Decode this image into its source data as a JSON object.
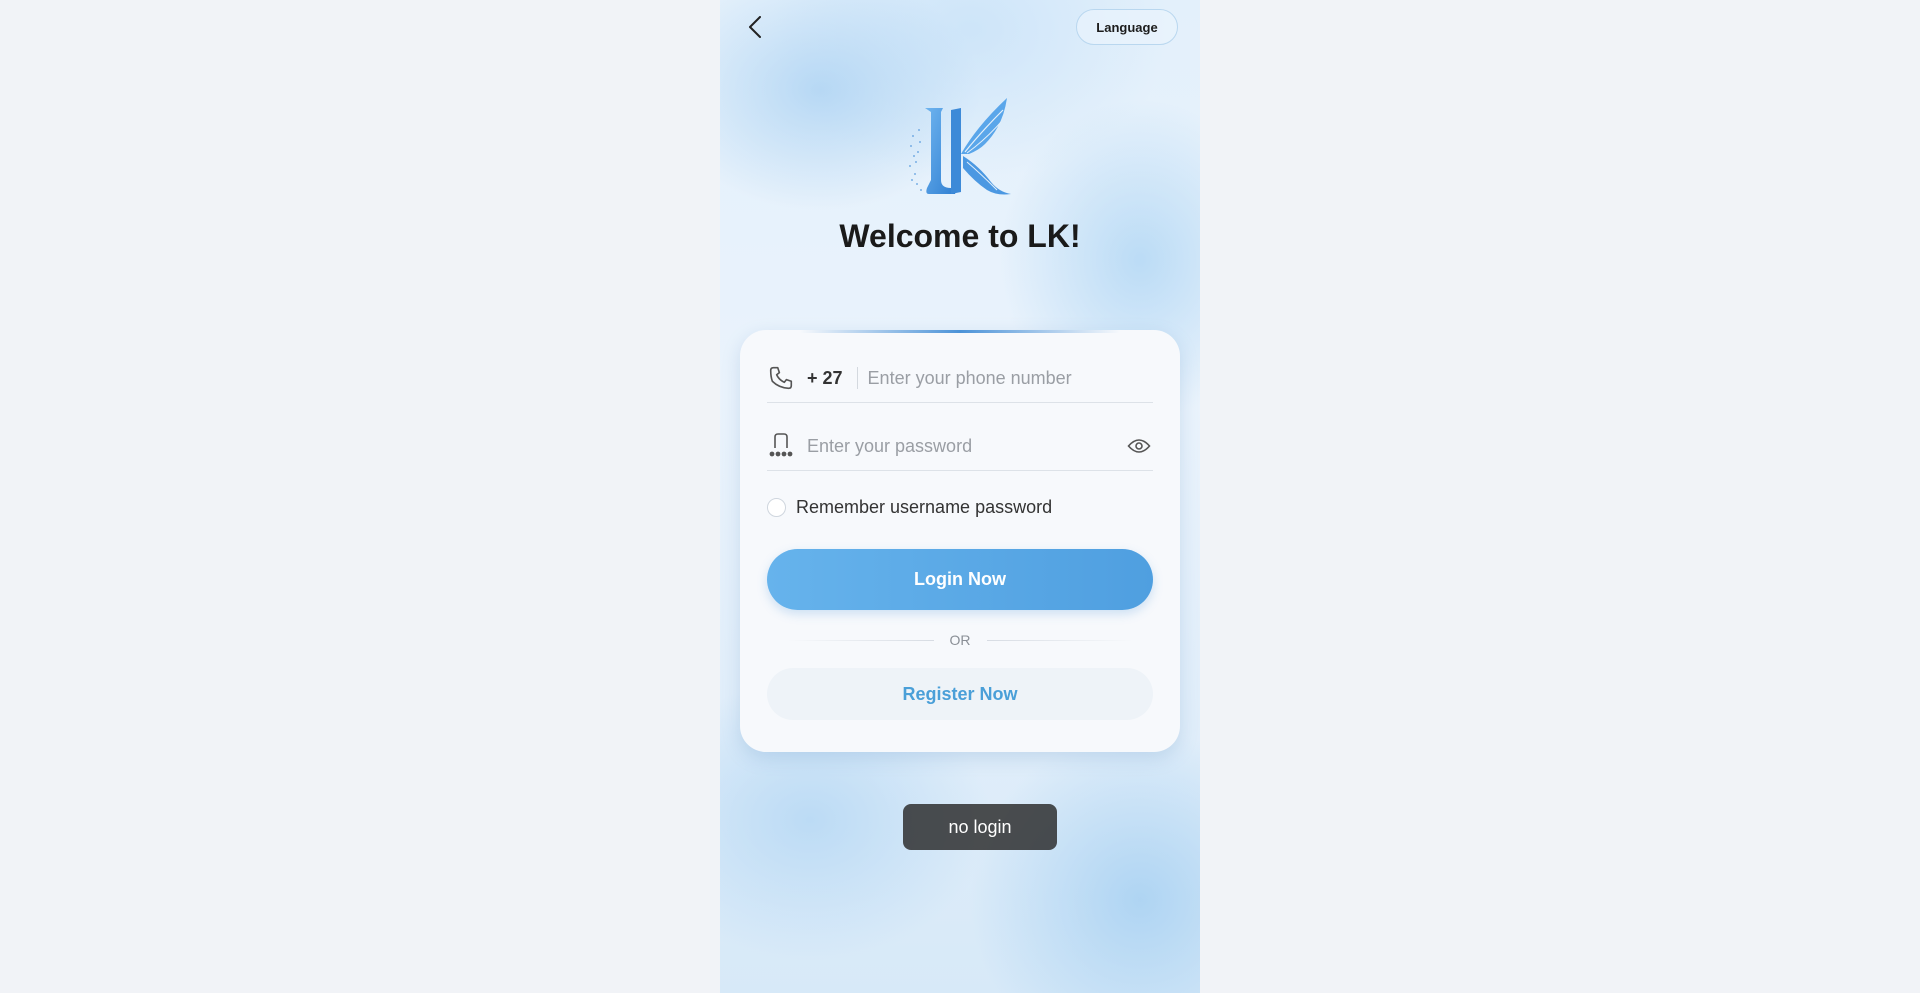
{
  "header": {
    "back_icon": "chevron-left-icon",
    "language_label": "Language"
  },
  "brand": {
    "logo_letters": "LK",
    "welcome_title": "Welcome to LK!"
  },
  "form": {
    "phone": {
      "icon": "phone-icon",
      "country_code": "+ 27",
      "placeholder": "Enter your phone number",
      "value": ""
    },
    "password": {
      "icon": "password-icon",
      "placeholder": "Enter your password",
      "value": "",
      "toggle_icon": "eye-icon"
    },
    "remember_label": "Remember username password",
    "remember_checked": false,
    "login_label": "Login Now",
    "divider_label": "OR",
    "register_label": "Register Now"
  },
  "toast": {
    "message": "no login"
  },
  "colors": {
    "accent": "#4f9fe0",
    "register_text": "#4a9fd8",
    "background": "#f1f3f7"
  }
}
